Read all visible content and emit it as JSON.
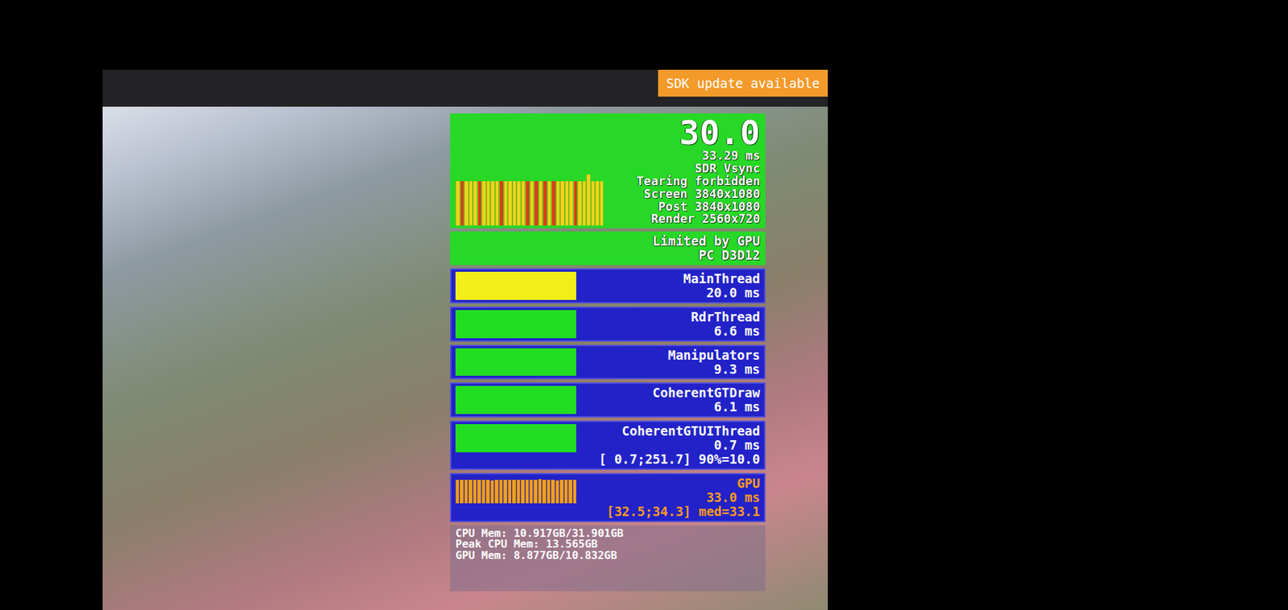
{
  "badge": "SDK update available",
  "fps": {
    "value": "30.0",
    "frame_time": "33.29 ms",
    "lines": [
      "SDR Vsync",
      "Tearing forbidden",
      "Screen 3840x1080",
      "Post 3840x1080",
      "Render 2560x720"
    ],
    "frame_bars": [
      {
        "value": 33.3,
        "color": "#f2d41a"
      },
      {
        "value": 33.3,
        "color": "#e03a1e"
      },
      {
        "value": 33.3,
        "color": "#f2d41a"
      },
      {
        "value": 33.3,
        "color": "#f2d41a"
      },
      {
        "value": 33.3,
        "color": "#f2d41a"
      },
      {
        "value": 33.3,
        "color": "#e03a1e"
      },
      {
        "value": 33.3,
        "color": "#f2d41a"
      },
      {
        "value": 33.3,
        "color": "#f2d41a"
      },
      {
        "value": 33.3,
        "color": "#f2d41a"
      },
      {
        "value": 33.3,
        "color": "#f2d41a"
      },
      {
        "value": 33.3,
        "color": "#e03a1e"
      },
      {
        "value": 33.3,
        "color": "#f2d41a"
      },
      {
        "value": 33.3,
        "color": "#f2d41a"
      },
      {
        "value": 33.3,
        "color": "#f2d41a"
      },
      {
        "value": 33.3,
        "color": "#f2d41a"
      },
      {
        "value": 33.3,
        "color": "#f2d41a"
      },
      {
        "value": 33.3,
        "color": "#e03a1e"
      },
      {
        "value": 33.3,
        "color": "#f2d41a"
      },
      {
        "value": 33.3,
        "color": "#e03a1e"
      },
      {
        "value": 33.3,
        "color": "#f2d41a"
      },
      {
        "value": 33.3,
        "color": "#e03a1e"
      },
      {
        "value": 33.3,
        "color": "#f2d41a"
      },
      {
        "value": 33.3,
        "color": "#e03a1e"
      },
      {
        "value": 33.3,
        "color": "#f2d41a"
      },
      {
        "value": 33.3,
        "color": "#f2d41a"
      },
      {
        "value": 33.3,
        "color": "#f2d41a"
      },
      {
        "value": 33.3,
        "color": "#f2d41a"
      },
      {
        "value": 33.3,
        "color": "#e03a1e"
      },
      {
        "value": 33.3,
        "color": "#f2d41a"
      },
      {
        "value": 33.3,
        "color": "#f2d41a"
      },
      {
        "value": 38.0,
        "color": "#f2d41a"
      },
      {
        "value": 33.3,
        "color": "#f2d41a"
      },
      {
        "value": 33.3,
        "color": "#f2d41a"
      },
      {
        "value": 33.3,
        "color": "#f2d41a"
      }
    ]
  },
  "limit": [
    "Limited by GPU",
    "PC D3D12"
  ],
  "threads": [
    {
      "name": "MainThread",
      "reading": "20.0 ms",
      "level": 1.0,
      "color": "#f2ee1a"
    },
    {
      "name": "RdrThread",
      "reading": "6.6 ms",
      "level": 1.0,
      "color": "#22dd22"
    },
    {
      "name": "Manipulators",
      "reading": "9.3 ms",
      "level": 1.0,
      "color": "#22dd22"
    },
    {
      "name": "CoherentGTDraw",
      "reading": "6.1 ms",
      "level": 1.0,
      "color": "#22dd22"
    },
    {
      "name": "CoherentGTUIThread",
      "reading": "0.7 ms",
      "level": 1.0,
      "color": "#22dd22",
      "extra": "[ 0.7;251.7] 90%=10.0"
    }
  ],
  "gpu": {
    "name": "GPU",
    "reading": "33.0 ms",
    "range": "[32.5;34.3] med=33.1",
    "history": [
      33.1,
      33.0,
      33.2,
      32.9,
      33.1,
      33.0,
      33.3,
      33.1,
      32.8,
      33.0,
      33.2,
      33.1,
      33.0,
      32.9,
      33.1,
      33.2,
      33.0,
      33.1,
      33.0,
      34.3,
      33.1,
      33.0,
      33.2,
      32.5,
      33.0,
      33.1,
      33.0,
      33.2
    ]
  },
  "memory": [
    "CPU Mem: 10.917GB/31.901GB",
    "Peak CPU Mem: 13.565GB",
    "GPU Mem: 8.877GB/10.832GB"
  ]
}
